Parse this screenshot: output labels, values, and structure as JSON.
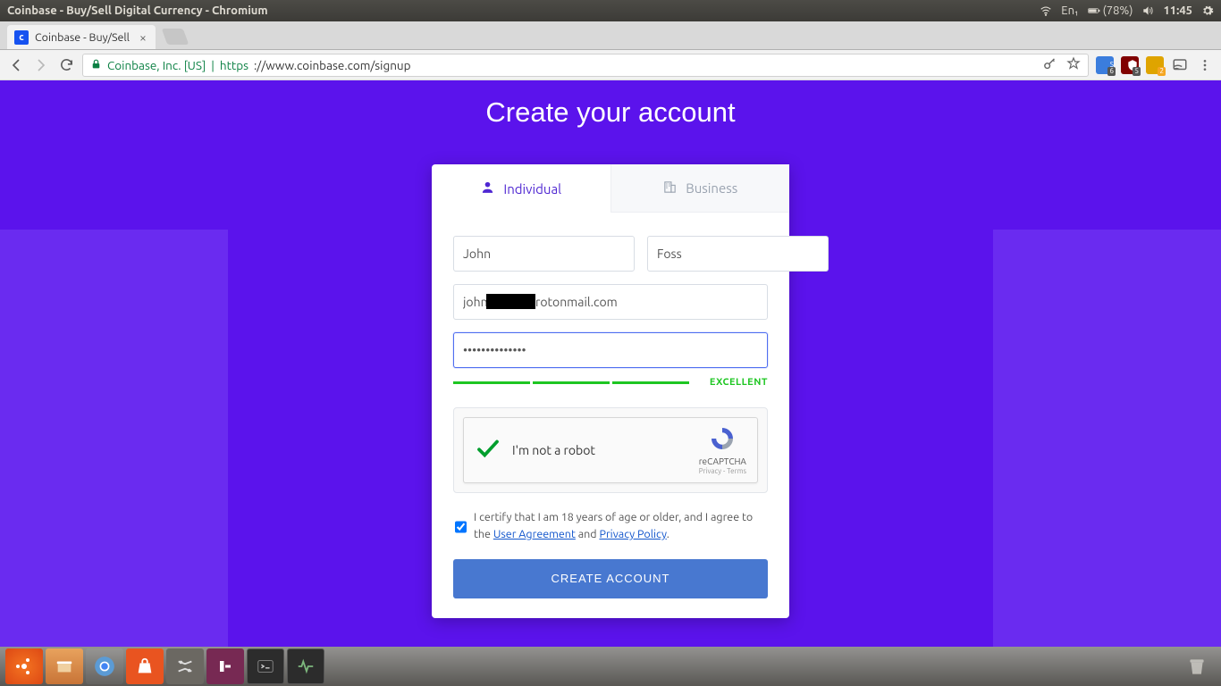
{
  "menubar": {
    "window_title": "Coinbase - Buy/Sell Digital Currency - Chromium",
    "lang": "En₁",
    "battery": "(78%)",
    "time": "11:45"
  },
  "tabstrip": {
    "tab_title": "Coinbase - Buy/Sell",
    "favicon_letter": "c"
  },
  "toolbar": {
    "ev_name": "Coinbase, Inc. [US]",
    "protocol": "https",
    "url_rest": "://www.coinbase.com/signup",
    "ext_badges": {
      "a": "6",
      "b": "5",
      "c": "2"
    }
  },
  "page": {
    "title": "Create your account",
    "tabs": {
      "individual": "Individual",
      "business": "Business"
    },
    "first_name": "John",
    "last_name": "Foss",
    "email": "john          @protonmail.com",
    "password": "••••••••••••••",
    "strength_label": "EXCELLENT",
    "captcha_text": "I'm not a robot",
    "captcha_brand": "reCAPTCHA",
    "captcha_pt": "Privacy - Terms",
    "agree_pre": "I certify that I am 18 years of age or older, and I agree to the ",
    "agree_ua": "User Agreement",
    "agree_and": " and ",
    "agree_pp": "Privacy Policy",
    "agree_dot": ".",
    "submit": "CREATE ACCOUNT"
  }
}
